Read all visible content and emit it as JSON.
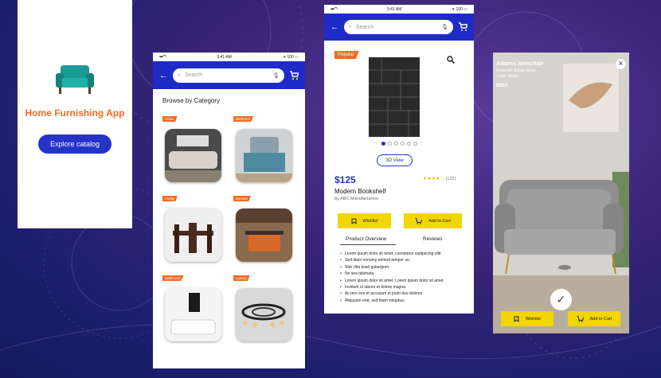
{
  "colors": {
    "brand_blue": "#1f2bc7",
    "accent_orange": "#f26b21",
    "button_yellow": "#f2d600",
    "rating_gold": "#e6b800"
  },
  "splash": {
    "title": "Home Furnishing App",
    "cta_label": "Explore catalog",
    "icon": "armchair-illustration"
  },
  "status_bar": {
    "time": "9:41 AM",
    "battery": "100"
  },
  "categories_screen": {
    "search_placeholder": "Search",
    "heading": "Browse by Category",
    "categories": [
      {
        "label": "Sofas"
      },
      {
        "label": "Bedroom"
      },
      {
        "label": "Living"
      },
      {
        "label": "Kitchen"
      },
      {
        "label": "Bathroom"
      },
      {
        "label": "Luxury"
      }
    ]
  },
  "product_screen": {
    "search_placeholder": "Search",
    "badge": "Popular",
    "price": "$125",
    "rating_stars": "★★★★☆",
    "rating": 4.5,
    "review_count": "(132)",
    "name": "Modern Bookshelf",
    "manufacturer": "by ABC Manufacturers",
    "view_3d_label": "3D View",
    "wishlist_label": "Wishlist",
    "cart_label": "Add to Cart",
    "tabs": [
      "Product Overview",
      "Reviews"
    ],
    "image_pages": 6,
    "active_page": 1,
    "overview_bullets": [
      "Lorem ipsum dolor sit amet, consetetur sadipscing elitr.",
      "Sed diam nonumy eirmod tempor un.",
      "Stet clita kasd gubergren.",
      "No sea takimata.",
      "Lorem ipsum dolor sit amet. Lorem ipsum dolor sit amet.",
      "Invidunt ut labore et dolore magna.",
      "At vero eos et accusam et justo duo dolores.",
      "Aliquyam erat, sed diam voluptua."
    ]
  },
  "ar_screen": {
    "name": "Adams Armchair",
    "material": "Material: Dove Grey,",
    "legs": "Legs: Brass",
    "price": "$560",
    "wishlist_label": "Wishlist",
    "cart_label": "Add to Cart"
  }
}
